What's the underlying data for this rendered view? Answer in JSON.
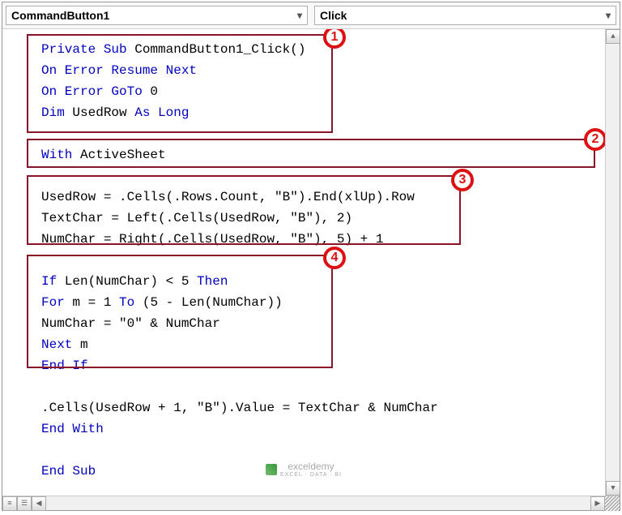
{
  "dropdowns": {
    "object": "CommandButton1",
    "event": "Click"
  },
  "annotations": {
    "b1": "1",
    "b2": "2",
    "b3": "3",
    "b4": "4"
  },
  "code": {
    "l1_a": "Private Sub",
    "l1_b": " CommandButton1_Click()",
    "l2_a": "On Error Resume Next",
    "l3_a": "On Error GoTo",
    "l3_b": " 0",
    "l4_a": "Dim",
    "l4_b": " UsedRow ",
    "l4_c": "As Long",
    "blank": "",
    "l5_a": "With",
    "l5_b": " ActiveSheet",
    "l6": "UsedRow = .Cells(.Rows.Count, \"B\").End(xlUp).Row",
    "l7": "TextChar = Left(.Cells(UsedRow, \"B\"), 2)",
    "l8": "NumChar = Right(.Cells(UsedRow, \"B\"), 5) + 1",
    "l9_a": "If",
    "l9_b": " Len(NumChar) < 5 ",
    "l9_c": "Then",
    "l10_a": "For",
    "l10_b": " m = 1 ",
    "l10_c": "To",
    "l10_d": " (5 - Len(NumChar))",
    "l11": "NumChar = \"0\" & NumChar",
    "l12_a": "Next",
    "l12_b": " m",
    "l13_a": "End If",
    "l14": ".Cells(UsedRow + 1, \"B\").Value = TextChar & NumChar",
    "l15_a": "End With",
    "l16_a": "End Sub"
  },
  "watermark": {
    "name": "exceldemy",
    "tag": "EXCEL · DATA · BI"
  }
}
